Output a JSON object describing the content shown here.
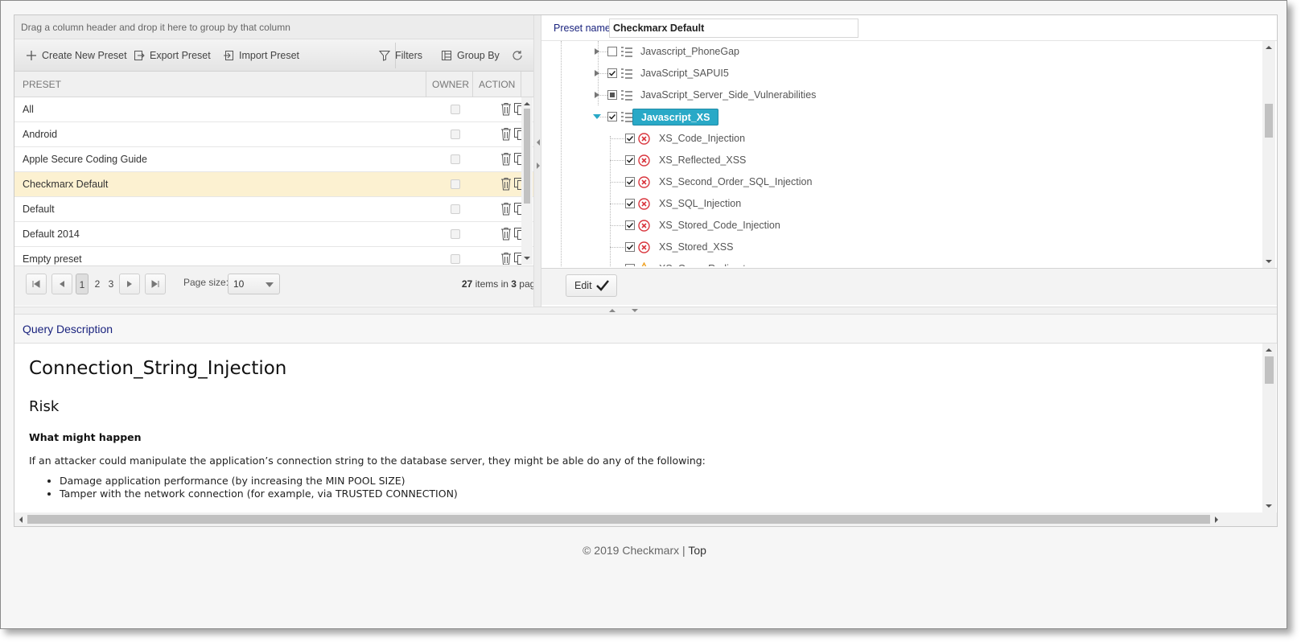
{
  "group_bar": {
    "hint": "Drag a column header and drop it here to group by that column"
  },
  "toolbar": {
    "create_label": "Create New Preset",
    "export_label": "Export Preset",
    "import_label": "Import Preset",
    "filters_label": "Filters",
    "group_by_label": "Group By"
  },
  "grid": {
    "columns": {
      "preset": "PRESET",
      "owner": "OWNER",
      "action": "ACTION"
    },
    "rows": [
      {
        "name": "All",
        "selected": false
      },
      {
        "name": "Android",
        "selected": false
      },
      {
        "name": "Apple Secure Coding Guide",
        "selected": false
      },
      {
        "name": "Checkmarx Default",
        "selected": true
      },
      {
        "name": "Default",
        "selected": false
      },
      {
        "name": "Default 2014",
        "selected": false
      },
      {
        "name": "Empty preset",
        "selected": false
      }
    ]
  },
  "pager": {
    "pages": [
      "1",
      "2",
      "3"
    ],
    "current_page": "1",
    "page_size_label": "Page size:",
    "page_size": "10",
    "total_items": "27",
    "items_in": "items in",
    "total_pages": "3",
    "pages_word": "pages"
  },
  "preset": {
    "label": "Preset name",
    "value": "Checkmarx Default"
  },
  "tree": {
    "parents": [
      {
        "label": "Javascript_PhoneGap",
        "state": "unchecked",
        "expanded": false
      },
      {
        "label": "JavaScript_SAPUI5",
        "state": "checked",
        "expanded": false
      },
      {
        "label": "JavaScript_Server_Side_Vulnerabilities",
        "state": "partial",
        "expanded": false
      },
      {
        "label": "Javascript_XS",
        "state": "checked",
        "expanded": true,
        "highlighted": true
      }
    ],
    "children": [
      {
        "label": "XS_Code_Injection",
        "severity": "high"
      },
      {
        "label": "XS_Reflected_XSS",
        "severity": "high"
      },
      {
        "label": "XS_Second_Order_SQL_Injection",
        "severity": "high"
      },
      {
        "label": "XS_SQL_Injection",
        "severity": "high"
      },
      {
        "label": "XS_Stored_Code_Injection",
        "severity": "high"
      },
      {
        "label": "XS_Stored_XSS",
        "severity": "high"
      },
      {
        "label": "XS_Open_Redirect",
        "severity": "medium"
      }
    ]
  },
  "edit": {
    "label": "Edit"
  },
  "description": {
    "header": "Query Description",
    "title": "Connection_String_Injection",
    "section": "Risk",
    "subheading": "What might happen",
    "paragraph": "If an attacker could manipulate the application’s connection string to the database server, they might be able do any of the following:",
    "bullets": [
      "Damage application performance (by increasing the MIN POOL SIZE)",
      "Tamper with the network connection (for example, via TRUSTED CONNECTION)"
    ]
  },
  "footer": {
    "copyright": "© 2019 Checkmarx",
    "separator": "|",
    "top_link": "Top"
  },
  "colors": {
    "selected_row": "#fcf1d1",
    "tree_highlight": "#29a9c7",
    "high_severity": "#d9363e",
    "medium_severity": "#f0a020",
    "label_blue": "#1a237e"
  }
}
